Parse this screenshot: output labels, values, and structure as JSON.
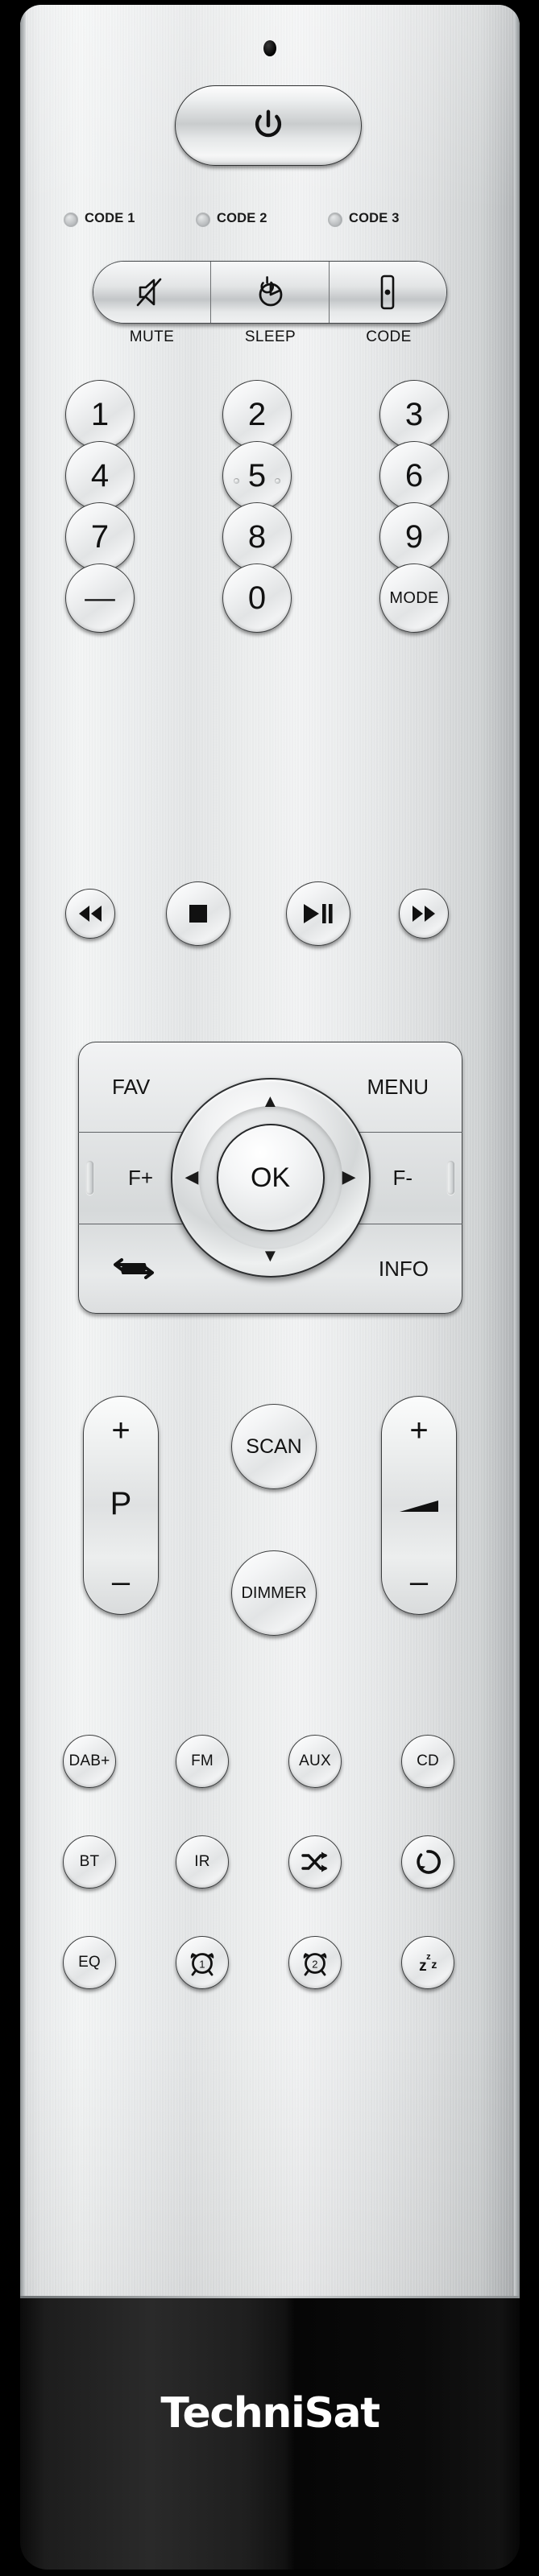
{
  "device": {
    "brand": "TechniSat",
    "type": "remote-control",
    "body_color": "#e5e7e8",
    "footer_color": "#111111",
    "accent_text_color": "#111111"
  },
  "top": {
    "ir_led": "ir-led-indicator",
    "power_button": {
      "label": "",
      "icon": "power-icon"
    }
  },
  "code_leds": [
    {
      "label": "CODE 1",
      "icon": "led-indicator"
    },
    {
      "label": "CODE 2",
      "icon": "led-indicator"
    },
    {
      "label": "CODE 3",
      "icon": "led-indicator"
    }
  ],
  "function_bar": [
    {
      "label": "MUTE",
      "icon": "mute-speaker-icon"
    },
    {
      "label": "SLEEP",
      "icon": "sleep-timer-icon"
    },
    {
      "label": "CODE",
      "icon": "code-remote-icon"
    }
  ],
  "keypad": {
    "rows": [
      [
        {
          "label": "1"
        },
        {
          "label": "2"
        },
        {
          "label": "3"
        }
      ],
      [
        {
          "label": "4"
        },
        {
          "label": "5",
          "tactile_dots": true
        },
        {
          "label": "6"
        }
      ],
      [
        {
          "label": "7"
        },
        {
          "label": "8"
        },
        {
          "label": "9"
        }
      ],
      [
        {
          "label": "––"
        },
        {
          "label": "0"
        },
        {
          "label": "MODE"
        }
      ]
    ]
  },
  "transport": [
    {
      "label": "",
      "icon": "rewind-icon"
    },
    {
      "label": "",
      "icon": "stop-icon"
    },
    {
      "label": "",
      "icon": "play-pause-icon"
    },
    {
      "label": "",
      "icon": "fast-forward-icon"
    }
  ],
  "navigation": {
    "fav": "FAV",
    "menu": "MENU",
    "f_plus": "F+",
    "f_minus": "F-",
    "info": "INFO",
    "repeat_icon": "repeat-loop-icon",
    "ok": "OK",
    "up_icon": "▲",
    "down_icon": "▼",
    "left_icon": "◀",
    "right_icon": "▶"
  },
  "middle_controls": {
    "program": {
      "plus": "+",
      "label": "P",
      "minus": "–"
    },
    "scan": "SCAN",
    "dimmer": "DIMMER",
    "volume": {
      "plus": "+",
      "icon": "volume-wedge-icon",
      "minus": "–"
    }
  },
  "sources": [
    {
      "label": "DAB+"
    },
    {
      "label": "FM"
    },
    {
      "label": "AUX"
    },
    {
      "label": "CD"
    }
  ],
  "modes": [
    {
      "label": "BT"
    },
    {
      "label": "IR"
    },
    {
      "label": "",
      "icon": "shuffle-icon"
    },
    {
      "label": "",
      "icon": "repeat-circle-icon"
    }
  ],
  "extras": [
    {
      "label": "EQ"
    },
    {
      "label": "1",
      "icon": "alarm-clock-1-icon"
    },
    {
      "label": "2",
      "icon": "alarm-clock-2-icon"
    },
    {
      "label": "",
      "icon": "sleep-zzz-icon"
    }
  ],
  "footer": {
    "logo": "TechniSat"
  }
}
